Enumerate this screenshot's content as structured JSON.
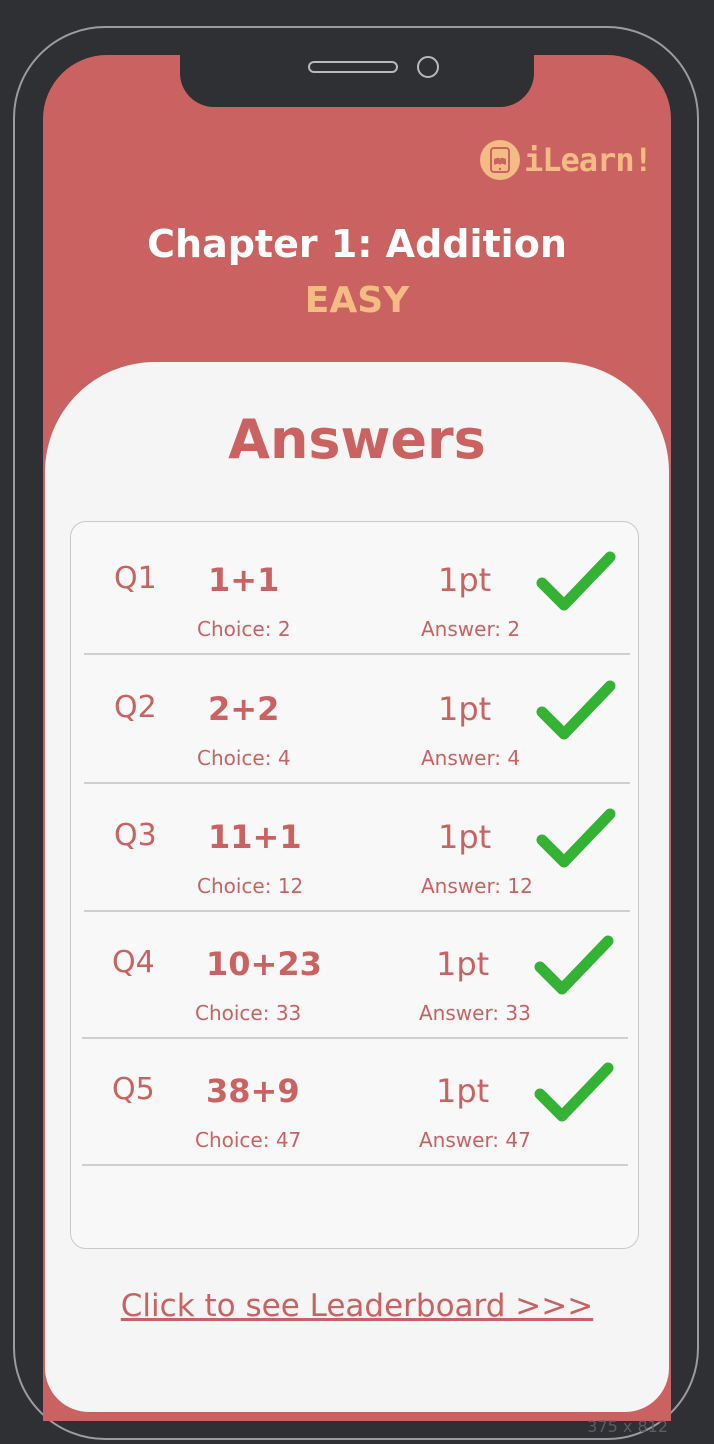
{
  "app": {
    "logo_text": "iLearn!",
    "logo_icon": "tablet-book-icon"
  },
  "header": {
    "chapter_title": "Chapter 1: Addition",
    "difficulty": "EASY"
  },
  "main": {
    "heading": "Answers",
    "rows": [
      {
        "label": "Q1",
        "expression": "1+1",
        "choice": "Choice: 2",
        "points": "1pt",
        "answer": "Answer: 2",
        "status_icon": "checkmark-icon"
      },
      {
        "label": "Q2",
        "expression": "2+2",
        "choice": "Choice: 4",
        "points": "1pt",
        "answer": "Answer: 4",
        "status_icon": "checkmark-icon"
      },
      {
        "label": "Q3",
        "expression": "11+1",
        "choice": "Choice: 12",
        "points": "1pt",
        "answer": "Answer: 12",
        "status_icon": "checkmark-icon"
      },
      {
        "label": "Q4",
        "expression": "10+23",
        "choice": "Choice: 33",
        "points": "1pt",
        "answer": "Answer: 33",
        "status_icon": "checkmark-icon"
      },
      {
        "label": "Q5",
        "expression": "38+9",
        "choice": "Choice: 47",
        "points": "1pt",
        "answer": "Answer: 47",
        "status_icon": "checkmark-icon"
      }
    ],
    "leaderboard_link": "Click to see Leaderboard >>>"
  },
  "frame_size_label": "375 x 812",
  "colors": {
    "accent": "#cb6262",
    "highlight": "#f5bb85",
    "correct": "#34b233",
    "background": "#2f3034"
  }
}
